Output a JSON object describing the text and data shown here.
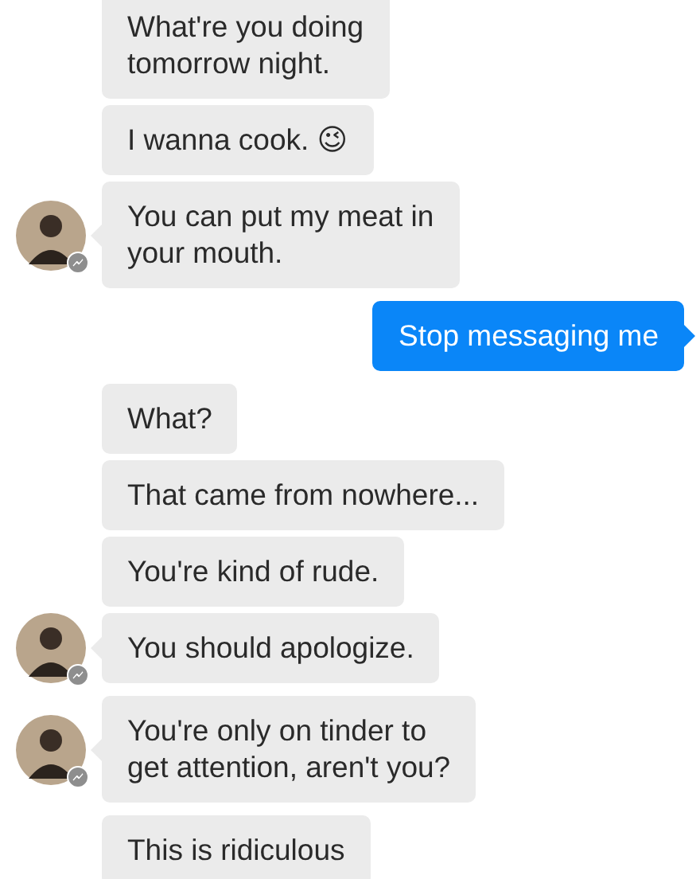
{
  "messages": [
    {
      "kind": "received",
      "lines": [
        "What're you doing",
        "tomorrow night."
      ],
      "avatar": false
    },
    {
      "kind": "received",
      "lines": [
        "I wanna cook. 😉"
      ],
      "avatar": false
    },
    {
      "kind": "received",
      "lines": [
        "You can put my meat in",
        "your mouth."
      ],
      "avatar": true
    },
    {
      "kind": "sent",
      "lines": [
        "Stop messaging me"
      ],
      "avatar": false
    },
    {
      "kind": "received",
      "lines": [
        "What?"
      ],
      "avatar": false
    },
    {
      "kind": "received",
      "lines": [
        "That came from nowhere..."
      ],
      "avatar": false
    },
    {
      "kind": "received",
      "lines": [
        "You're kind of rude."
      ],
      "avatar": false
    },
    {
      "kind": "received",
      "lines": [
        "You should apologize."
      ],
      "avatar": true
    },
    {
      "kind": "received",
      "lines": [
        "You're only on tinder to",
        "get attention, aren't you?"
      ],
      "avatar": true
    },
    {
      "kind": "received",
      "lines": [
        "This is ridiculous"
      ],
      "avatar": false
    }
  ]
}
